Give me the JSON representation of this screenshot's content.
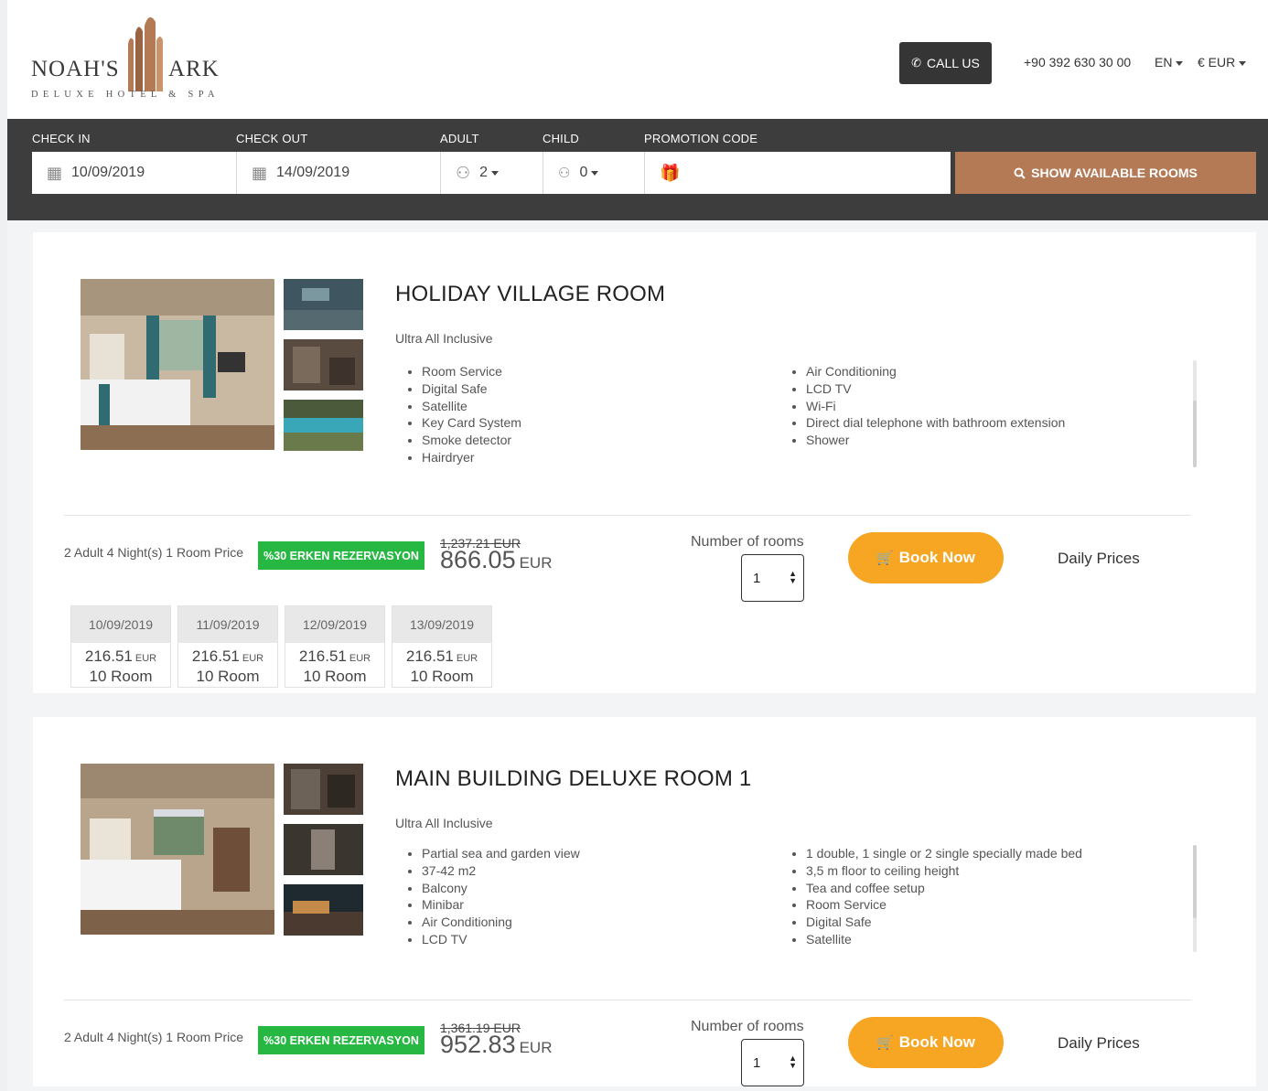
{
  "header": {
    "logo": {
      "word_left": "NOAH'S",
      "word_right": "ARK",
      "tagline": "DELUXE HOTEL & SPA"
    },
    "call_button": "CALL US",
    "phone": "+90 392 630 30 00",
    "language": "EN",
    "currency": "€ EUR"
  },
  "search": {
    "check_in_label": "CHECK IN",
    "check_in_value": "10/09/2019",
    "check_out_label": "CHECK OUT",
    "check_out_value": "14/09/2019",
    "adult_label": "ADULT",
    "adult_value": "2",
    "child_label": "CHILD",
    "child_value": "0",
    "promo_label": "PROMOTION CODE",
    "promo_value": "",
    "show_button": "SHOW AVAILABLE ROOMS"
  },
  "rooms": [
    {
      "title": "HOLIDAY VILLAGE ROOM",
      "board": "Ultra All Inclusive",
      "features_left": [
        "Room Service",
        "Digital Safe",
        "Satellite",
        "Key Card System",
        "Smoke detector",
        "Hairdryer"
      ],
      "features_right": [
        "Air Conditioning",
        "LCD TV",
        "Wi-Fi",
        "Direct dial telephone with bathroom extension",
        "Shower"
      ],
      "price_label": "2 Adult 4 Night(s) 1 Room Price",
      "promo": "%30 ERKEN REZERVASYON",
      "old_price": "1,237.21 EUR",
      "new_price": "866.05",
      "currency": "EUR",
      "rooms_label": "Number of rooms",
      "rooms_value": "1",
      "book_label": "Book Now",
      "daily_label": "Daily Prices",
      "days": [
        {
          "date": "10/09/2019",
          "price": "216.51",
          "cur": "EUR",
          "rooms": "10 Room"
        },
        {
          "date": "11/09/2019",
          "price": "216.51",
          "cur": "EUR",
          "rooms": "10 Room"
        },
        {
          "date": "12/09/2019",
          "price": "216.51",
          "cur": "EUR",
          "rooms": "10 Room"
        },
        {
          "date": "13/09/2019",
          "price": "216.51",
          "cur": "EUR",
          "rooms": "10 Room"
        }
      ]
    },
    {
      "title": "MAIN BUILDING DELUXE ROOM 1",
      "board": "Ultra All Inclusive",
      "features_left": [
        "Partial sea and garden view",
        "37-42 m2",
        "Balcony",
        "Minibar",
        "Air Conditioning",
        "LCD TV"
      ],
      "features_right": [
        "1 double, 1 single or 2 single specially made bed",
        "3,5 m floor to ceiling height",
        "Tea and coffee setup",
        "Room Service",
        "Digital Safe",
        "Satellite"
      ],
      "price_label": "2 Adult 4 Night(s) 1 Room Price",
      "promo": "%30 ERKEN REZERVASYON",
      "old_price": "1,361.19 EUR",
      "new_price": "952.83",
      "currency": "EUR",
      "rooms_label": "Number of rooms",
      "rooms_value": "1",
      "book_label": "Book Now",
      "daily_label": "Daily Prices"
    }
  ],
  "colors": {
    "search_bar": "#3d3d3d",
    "show_button": "#b47a56",
    "book_button": "#f6a622",
    "promo_badge": "#27b844"
  }
}
